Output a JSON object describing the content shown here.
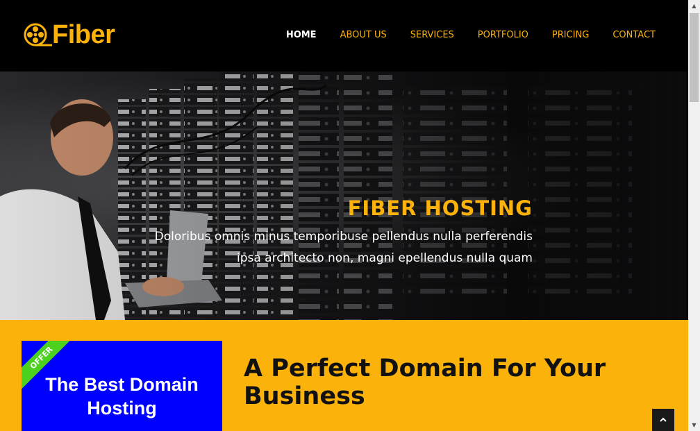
{
  "brand": {
    "name": "Fiber",
    "color": "#fbb20a"
  },
  "nav": {
    "items": [
      {
        "label": "HOME"
      },
      {
        "label": "ABOUT US"
      },
      {
        "label": "SERVICES"
      },
      {
        "label": "PORTFOLIO"
      },
      {
        "label": "PRICING"
      },
      {
        "label": "CONTACT"
      }
    ],
    "active": "HOME"
  },
  "hero": {
    "title": "FIBER HOSTING",
    "text": "Doloribus omnis minus temporibuse pellendus nulla perferendis ipsa architecto non, magni epellendus nulla quam"
  },
  "promo": {
    "ribbon": "OFFER",
    "title": "The Best Domain Hosting",
    "heading": "A Perfect Domain For Your Business"
  },
  "icons": {
    "logo": "film-reel-icon",
    "back_to_top": "chevron-up-icon"
  },
  "colors": {
    "accent": "#fbb20a",
    "offer_bg": "#0000ff",
    "ribbon": "#4cd11f"
  }
}
